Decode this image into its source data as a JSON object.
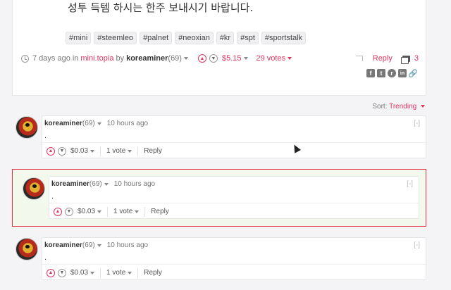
{
  "post": {
    "text": "성투 득템 하시는 한주 보내시기 바랍니다.",
    "tags": [
      "#mini",
      "#steemleo",
      "#palnet",
      "#neoxian",
      "#kr",
      "#spt",
      "#sportstalk"
    ],
    "time": "7 days ago",
    "in_label": "in",
    "community": "mini.topia",
    "by_label": "by",
    "author": "koreaminer",
    "reputation": "(69)",
    "payout": "$5.15",
    "votes": "29 votes",
    "reply_label": "Reply",
    "comment_count": "3"
  },
  "sort": {
    "label": "Sort:",
    "value": "Trending"
  },
  "comments": [
    {
      "author": "koreaminer",
      "reputation": "(69)",
      "time": "10 hours ago",
      "body": ".",
      "payout": "$0.03",
      "votes": "1 vote",
      "reply_label": "Reply",
      "collapse": "[-]"
    },
    {
      "author": "koreaminer",
      "reputation": "(69)",
      "time": "10 hours ago",
      "body": ".",
      "payout": "$0.03",
      "votes": "1 vote",
      "reply_label": "Reply",
      "collapse": "[-]"
    },
    {
      "author": "koreaminer",
      "reputation": "(69)",
      "time": "10 hours ago",
      "body": ".",
      "payout": "$0.03",
      "votes": "1 vote",
      "reply_label": "Reply",
      "collapse": "[-]"
    }
  ],
  "icons": {
    "upvote": "▲",
    "downvote": "▼",
    "share_facebook": "f",
    "share_twitter": "t",
    "share_reddit": "r",
    "share_linkedin": "in",
    "share_link": "🔗"
  },
  "colors": {
    "accent": "#e2345f",
    "highlight_border": "#e5303f",
    "highlight_bg": "#f2f8ec"
  }
}
